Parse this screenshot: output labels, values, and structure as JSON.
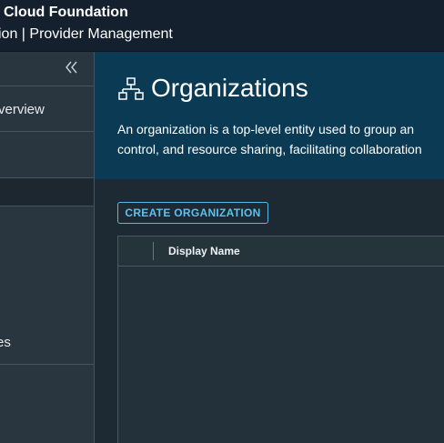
{
  "app": {
    "brand": "Cloud Foundation",
    "subtitle": "ion | Provider Management"
  },
  "sidebar": {
    "collapse_icon": "double-chevron-left-icon",
    "items": [
      {
        "label": "verview"
      },
      {
        "label": ""
      },
      {
        "label": ""
      },
      {
        "label": "es"
      }
    ]
  },
  "page": {
    "icon": "organization-icon",
    "title": "Organizations",
    "description_lines": [
      "An organization is a top-level entity used to group an",
      "control, and resource sharing, facilitating collaboration"
    ]
  },
  "toolbar": {
    "create_label": "CREATE ORGANIZATION"
  },
  "grid": {
    "columns": [
      "Display Name"
    ],
    "rows": []
  },
  "colors": {
    "topbar": "#14202e",
    "header": "#0b3a54",
    "sidebar": "#2a363f",
    "accent": "#5fc0ef"
  }
}
